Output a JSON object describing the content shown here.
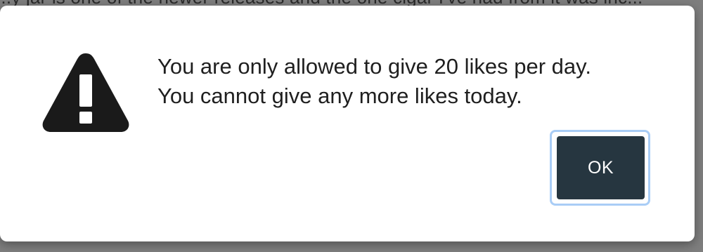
{
  "background": {
    "partial_text": "...y jar is one of the newer releases and the one cigar I've had from it was inc..."
  },
  "dialog": {
    "icon": "warning-triangle-icon",
    "message_line_1": "You are only allowed to give 20 likes per day.",
    "message_line_2": "You cannot give any more likes today.",
    "ok_label": "OK"
  },
  "colors": {
    "button_bg": "#263640",
    "focus_ring": "#a9cdf6",
    "icon": "#1a1a1a",
    "overlay": "#7e7e7e"
  }
}
